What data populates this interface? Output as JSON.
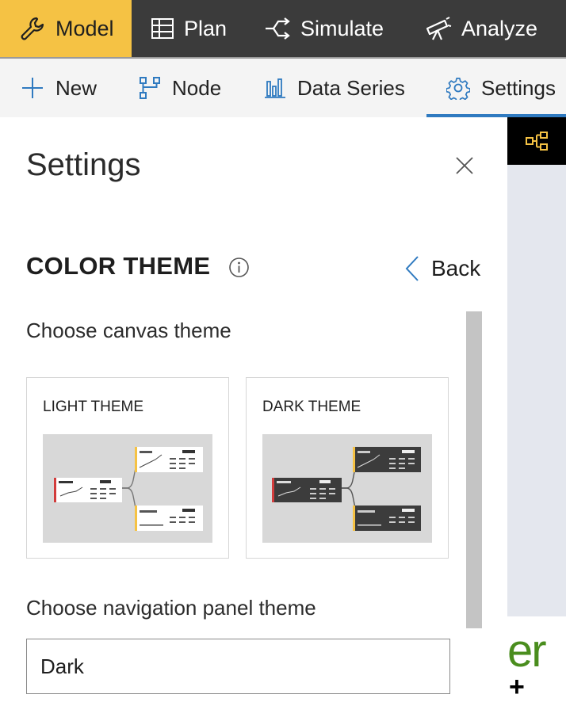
{
  "topbar": {
    "tabs": [
      {
        "label": "Model",
        "icon": "wrench-icon",
        "active": true
      },
      {
        "label": "Plan",
        "icon": "table-icon"
      },
      {
        "label": "Simulate",
        "icon": "branch-arrow-icon"
      },
      {
        "label": "Analyze",
        "icon": "telescope-icon"
      }
    ]
  },
  "ribbon": {
    "items": [
      {
        "label": "New",
        "icon": "plus-icon"
      },
      {
        "label": "Node",
        "icon": "node-tree-icon"
      },
      {
        "label": "Data Series",
        "icon": "bar-chart-icon"
      },
      {
        "label": "Settings",
        "icon": "gear-icon",
        "active": true
      }
    ]
  },
  "settings": {
    "title": "Settings",
    "section_title": "COLOR THEME",
    "back_label": "Back",
    "canvas_theme_label": "Choose canvas theme",
    "themes": [
      {
        "label": "LIGHT THEME"
      },
      {
        "label": "DARK THEME"
      }
    ],
    "nav_theme_label": "Choose navigation panel theme",
    "nav_theme_value": "Dark"
  },
  "canvas": {
    "partial_text": "er",
    "plus": "+"
  },
  "colors": {
    "accent_yellow": "#f5c244",
    "topbar_bg": "#3b3b3b",
    "active_underline": "#2f7ac0",
    "ribbon_icon_blue": "#2f7ac0"
  }
}
